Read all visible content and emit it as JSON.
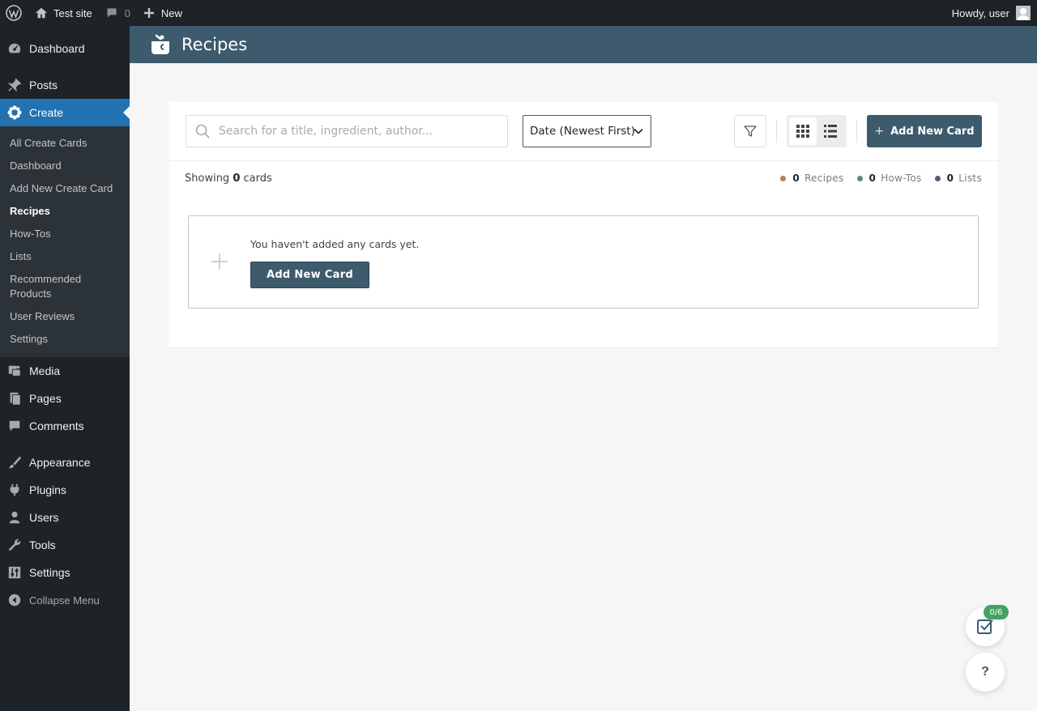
{
  "adminbar": {
    "site_name": "Test site",
    "comments_count": "0",
    "new_label": "New",
    "howdy": "Howdy, user"
  },
  "sidebar": {
    "items_top": [
      {
        "label": "Dashboard",
        "icon": "dashboard-icon"
      },
      {
        "label": "Posts",
        "icon": "pin-icon"
      },
      {
        "label": "Create",
        "icon": "create-flower-icon"
      }
    ],
    "submenu": [
      {
        "label": "All Create Cards"
      },
      {
        "label": "Dashboard"
      },
      {
        "label": "Add New Create Card"
      },
      {
        "label": "Recipes"
      },
      {
        "label": "How-Tos"
      },
      {
        "label": "Lists"
      },
      {
        "label": "Recommended Products"
      },
      {
        "label": "User Reviews"
      },
      {
        "label": "Settings"
      }
    ],
    "items_bottom": [
      {
        "label": "Media",
        "icon": "media-icon"
      },
      {
        "label": "Pages",
        "icon": "pages-icon"
      },
      {
        "label": "Comments",
        "icon": "comment-icon"
      },
      {
        "label": "Appearance",
        "icon": "brush-icon"
      },
      {
        "label": "Plugins",
        "icon": "plugin-icon"
      },
      {
        "label": "Users",
        "icon": "user-icon"
      },
      {
        "label": "Tools",
        "icon": "wrench-icon"
      },
      {
        "label": "Settings",
        "icon": "settings-sliders-icon"
      }
    ],
    "collapse_label": "Collapse Menu"
  },
  "header": {
    "title": "Recipes",
    "background": "#3e5b6d"
  },
  "toolbar": {
    "search_placeholder": "Search for a title, ingredient, author...",
    "sort_value": "Date (Newest First)",
    "add_new_label": "Add New Card"
  },
  "summary": {
    "showing_prefix": "Showing",
    "showing_count": "0",
    "showing_suffix": "cards",
    "counts": [
      {
        "count": "0",
        "label": "Recipes",
        "color": "#b87a5a"
      },
      {
        "count": "0",
        "label": "How-Tos",
        "color": "#5b8c6e"
      },
      {
        "count": "0",
        "label": "Lists",
        "color": "#6b4f7d"
      }
    ]
  },
  "empty_state": {
    "message": "You haven't added any cards yet.",
    "button_label": "Add New Card"
  },
  "floating": {
    "progress_badge": "0/6",
    "help_label": "?"
  },
  "colors": {
    "accent": "#3e5b6d",
    "wp_blue": "#2271b1",
    "badge_green": "#46a264"
  }
}
